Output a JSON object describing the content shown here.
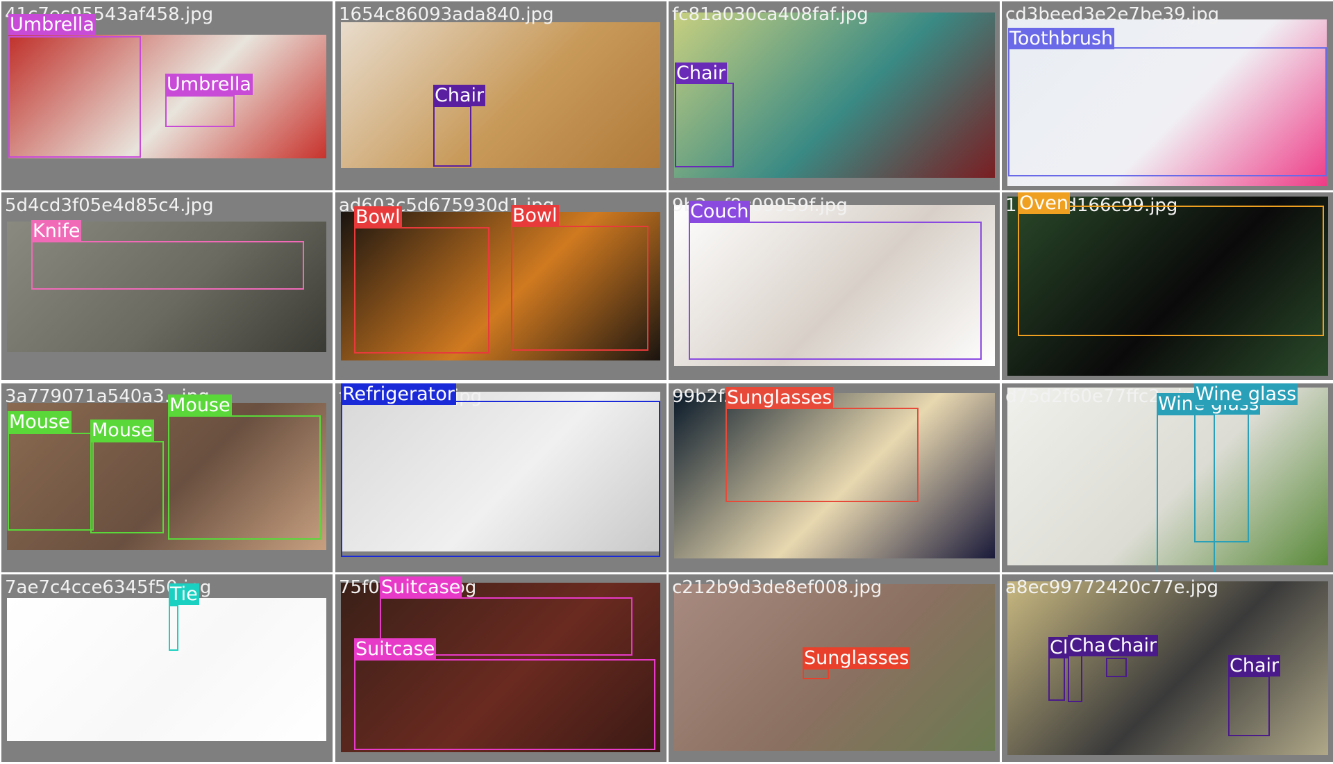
{
  "colors": {
    "tile_background": "#7f7f7f",
    "filename_text": "#f2f2f2",
    "label_text": "#ffffff"
  },
  "tiles": [
    {
      "filename": "41c7ec95543af458.jpg",
      "photo_colors": [
        "#c0302a",
        "#e8e4dc",
        "#c8322c"
      ],
      "detections": [
        {
          "label": "Umbrella",
          "color": "#c84bd8"
        },
        {
          "label": "Umbrella",
          "color": "#c84bd8"
        }
      ]
    },
    {
      "filename": "1654c86093ada840.jpg",
      "photo_colors": [
        "#e8dccc",
        "#c89a5a",
        "#b07a3a"
      ],
      "detections": [
        {
          "label": "Chair",
          "color": "#5a1fa0"
        }
      ]
    },
    {
      "filename": "fc81a030ca408faf.jpg",
      "photo_colors": [
        "#c8d080",
        "#3a8a84",
        "#7a1e22"
      ],
      "detections": [
        {
          "label": "Chair",
          "color": "#6a2ab8"
        }
      ]
    },
    {
      "filename": "cd3beed3e2e7be39.jpg",
      "photo_colors": [
        "#e8eef4",
        "#f0f0f4",
        "#ee3a86"
      ],
      "detections": [
        {
          "label": "Toothbrush",
          "color": "#6a6ae8"
        }
      ]
    },
    {
      "filename": "5d4cd3f05e4d85c4.jpg",
      "photo_colors": [
        "#8a8a80",
        "#6a6a60",
        "#3a3a34"
      ],
      "detections": [
        {
          "label": "Knife",
          "color": "#f06ab8"
        }
      ]
    },
    {
      "filename": "ad603c5d675930d1.jpg",
      "photo_colors": [
        "#1a1410",
        "#d07a20",
        "#1a1410"
      ],
      "detections": [
        {
          "label": "Bowl",
          "color": "#e83a3a"
        },
        {
          "label": "Bowl",
          "color": "#e83a3a"
        }
      ]
    },
    {
      "filename": "9b3...f8c09959f.jpg",
      "photo_colors": [
        "#ffffff",
        "#d8d0c8",
        "#ffffff"
      ],
      "detections": [
        {
          "label": "Couch",
          "color": "#8a4ae0"
        }
      ]
    },
    {
      "filename": "1...ccdd166c99.jpg",
      "photo_colors": [
        "#2a4a2a",
        "#0a0a0a",
        "#2a4a2a"
      ],
      "detections": [
        {
          "label": "Oven",
          "color": "#f0a020"
        }
      ]
    },
    {
      "filename": "3a779071a540a3...jpg",
      "photo_colors": [
        "#8a6a50",
        "#6a5040",
        "#c8a080"
      ],
      "detections": [
        {
          "label": "Mouse",
          "color": "#5ad83a"
        },
        {
          "label": "Mouse",
          "color": "#5ad83a"
        },
        {
          "label": "Mouse",
          "color": "#5ad83a"
        }
      ]
    },
    {
      "filename": "f...3c64c90c.jpg",
      "photo_colors": [
        "#d8d8d8",
        "#f0f0f0",
        "#c8c8c8"
      ],
      "detections": [
        {
          "label": "Refrigerator",
          "color": "#1a2ad8"
        }
      ]
    },
    {
      "filename": "99b2f...3.jpg",
      "photo_colors": [
        "#0a1a2a",
        "#e8d8b0",
        "#1a1a3a"
      ],
      "detections": [
        {
          "label": "Sunglasses",
          "color": "#e84a3a"
        }
      ]
    },
    {
      "filename": "d75d2f60e77ffc2...jpg",
      "photo_colors": [
        "#f0f0ec",
        "#dcdcd4",
        "#5a8a3a"
      ],
      "detections": [
        {
          "label": "Wine glass",
          "color": "#2aa0b8"
        },
        {
          "label": "Wine glass",
          "color": "#2aa0b8"
        }
      ]
    },
    {
      "filename": "7ae7c4cce6345f50.jpg",
      "photo_colors": [
        "#ffffff",
        "#f8f8f8",
        "#ffffff"
      ],
      "detections": [
        {
          "label": "Tie",
          "color": "#1ad0c0"
        }
      ]
    },
    {
      "filename": "75f0...332b.jpg",
      "photo_colors": [
        "#3a2018",
        "#6a2a20",
        "#3a1a14"
      ],
      "detections": [
        {
          "label": "Suitcase",
          "color": "#e83ac8"
        },
        {
          "label": "Suitcase",
          "color": "#e83ac8"
        }
      ]
    },
    {
      "filename": "c212b9d3de8ef008.jpg",
      "photo_colors": [
        "#a88a80",
        "#8a7060",
        "#6a7a50"
      ],
      "detections": [
        {
          "label": "Sunglasses",
          "color": "#e8402a"
        }
      ]
    },
    {
      "filename": "a8ec99772420c77e.jpg",
      "photo_colors": [
        "#c8b880",
        "#3a3a3a",
        "#b0a888"
      ],
      "detections": [
        {
          "label": "Cl",
          "color": "#4a1a8a"
        },
        {
          "label": "Cha",
          "color": "#4a1a8a"
        },
        {
          "label": "Chair",
          "color": "#4a1a8a"
        },
        {
          "label": "Chair",
          "color": "#4a1a8a"
        }
      ]
    }
  ]
}
